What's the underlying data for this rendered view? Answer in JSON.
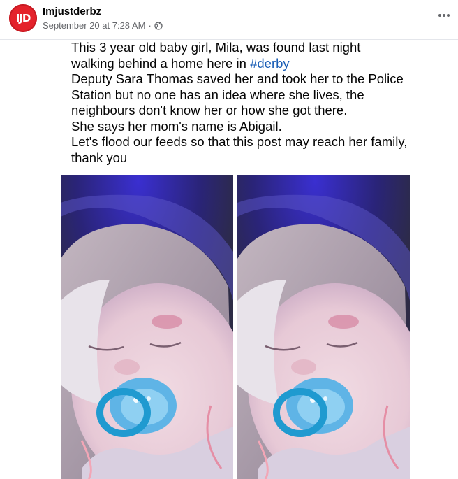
{
  "post": {
    "author": "Imjustderbz",
    "avatar_text": "IJD",
    "timestamp": "September 20 at 7:28 AM",
    "separator": "·",
    "privacy_icon": "globe-icon",
    "menu_icon": "more-options-icon",
    "text": {
      "line1": "This 3 year old baby girl, Mila, was found last night",
      "line2_prefix": "walking behind a home here in ",
      "hashtag": "#derby",
      "para2": "Deputy Sara Thomas saved her and took her to the Police Station but no one has an idea where she lives, the neighbours don't know her or how she got there.",
      "para3": "She says her mom's name is Abigail.",
      "para4": "Let's flood our feeds so that this post may reach her family, thank you"
    },
    "photos": [
      {
        "subject": "sleeping-toddler-with-pacifier"
      },
      {
        "subject": "sleeping-toddler-with-pacifier"
      }
    ]
  },
  "colors": {
    "accent_link": "#1a5eb6",
    "avatar_red": "#e4222b",
    "meta_gray": "#65676b",
    "text": "#050505"
  }
}
